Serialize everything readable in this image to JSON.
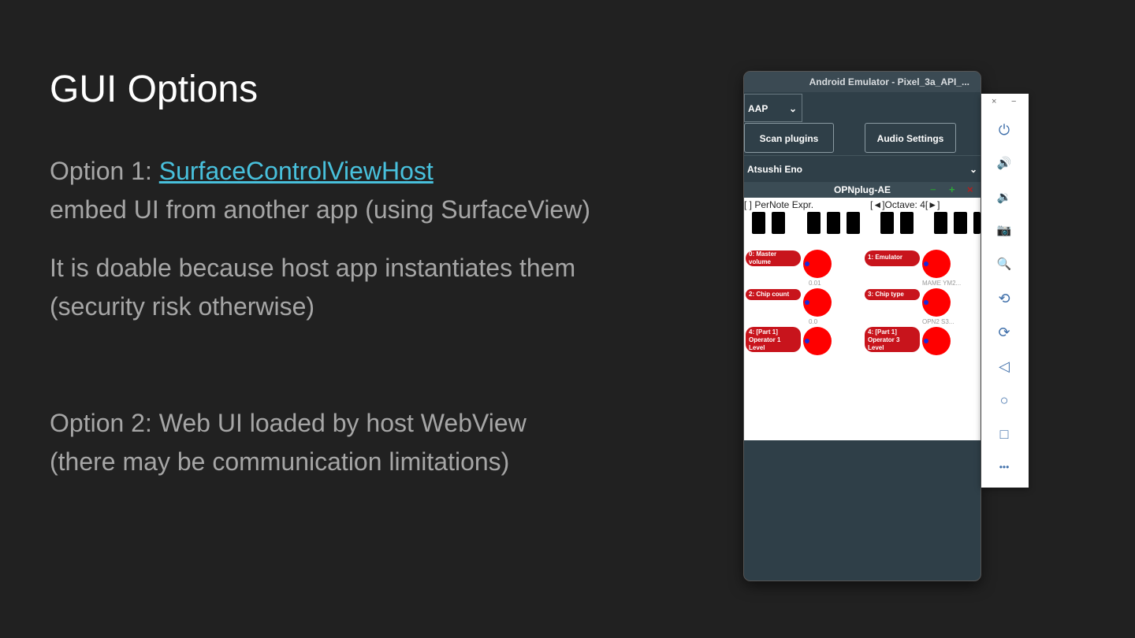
{
  "slide": {
    "title": "GUI Options",
    "option1_prefix": "Option 1: ",
    "option1_link": "SurfaceControlViewHost",
    "option1_detail": "embed UI from another app (using SurfaceView)",
    "doable_line1": "It is doable because host app instantiates them",
    "doable_line2": "(security risk otherwise)",
    "option2_line1": "Option 2: Web UI loaded by host WebView",
    "option2_line2": "(there may be communication limitations)",
    "link_color": "#48c0dc"
  },
  "emulator": {
    "window_title": "Android Emulator - Pixel_3a_API_...",
    "app": {
      "host_selector": "AAP",
      "scan_button": "Scan plugins",
      "audio_button": "Audio Settings",
      "user_selector": "Atsushi Eno",
      "plugin_name": "OPNplug-AE",
      "minus": "−",
      "plus": "+",
      "close": "×",
      "per_note": "[   ] PerNote Expr.",
      "octave": "[◄]Octave: 4[►]",
      "params": [
        {
          "label": "0: Master volume",
          "value": "0.01"
        },
        {
          "label": "1: Emulator",
          "value": "MAME YM2..."
        },
        {
          "label": "2: Chip count",
          "value": "0.0"
        },
        {
          "label": "3: Chip type",
          "value": "OPN2 S3..."
        },
        {
          "label": "4: [Part 1] Operator 1 Level",
          "value": ""
        },
        {
          "label": "4: [Part 1] Operator 3 Level",
          "value": ""
        }
      ]
    },
    "toolbar": {
      "close": "×",
      "minimize": "−",
      "icons": [
        "power-icon",
        "volume-up-icon",
        "volume-down-icon",
        "camera-icon",
        "zoom-icon",
        "rotate-left-icon",
        "rotate-right-icon",
        "back-icon",
        "home-icon",
        "overview-icon",
        "more-icon"
      ],
      "glyphs": [
        "⏻",
        "🔊",
        "🔉",
        "📷",
        "🔍",
        "⟲",
        "⟳",
        "◁",
        "○",
        "□",
        "•••"
      ]
    }
  }
}
